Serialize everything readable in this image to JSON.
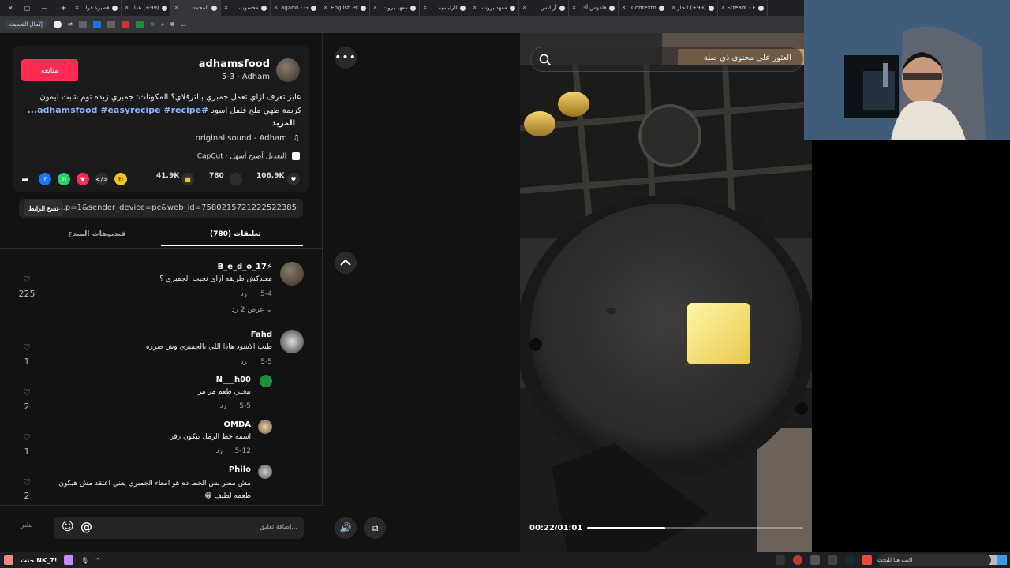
{
  "browser": {
    "tabs": [
      {
        "label": "قطيرة فرا..."
      },
      {
        "label": "(99+) هذا"
      },
      {
        "label": "المحمد",
        "active": true
      },
      {
        "label": "محسوب"
      },
      {
        "label": "agario - G"
      },
      {
        "label": "English Pr"
      },
      {
        "label": "معهد بروت"
      },
      {
        "label": "الرئيسية"
      },
      {
        "label": "معهد بروت"
      },
      {
        "label": "أرنلنس"
      },
      {
        "label": "قاموس أك"
      },
      {
        "label": "Contexto"
      },
      {
        "label": "(99+) الحار"
      },
      {
        "label": "Stream - F"
      }
    ],
    "new_tab": "+",
    "update_button": "إكمال التحديث"
  },
  "post": {
    "username": "adhamsfood",
    "meta": "5-3 · Adham",
    "follow_label": "متابعة",
    "description": "عايز تعرف ازاي تعمل جمبري بالترفلاي؟ المكونات: جمبري زبده ثوم شبت ليمون كريمة طهي ملح فلفل اسود",
    "hashtags": "#adhamsfood #easyrecipe #recipe...",
    "more_label": "المزيد",
    "sound": "original sound - Adham",
    "capcut": "CapCut · التعديل أصبح أسهل",
    "likes": "106.9K",
    "comments_count": "780",
    "saves": "41.9K",
    "link": "...p=1&sender_device=pc&web_id=7580215721222522385",
    "copy_link": "نسخ الرابط",
    "tab_comments": "تعليقات (780)",
    "tab_creator": "فيديوهات المبدع"
  },
  "comments": [
    {
      "name": "B_e_d_o_17⚡",
      "text": "معندكش طريقه ازاي نجيب الجمبري ؟",
      "date": "5-4",
      "reply": "رد",
      "likes": "225",
      "view_replies": "عرض 2 رد"
    },
    {
      "name": "Fahd",
      "text": "طيب الاسود هاذا اللي بالجمبري وش ضرره",
      "date": "5-5",
      "reply": "رد",
      "likes": "1"
    },
    {
      "name": "N___h00",
      "text": "بيخلي طعم مر مر",
      "date": "5-5",
      "reply": "رد",
      "likes": "2"
    },
    {
      "name": "OMDA",
      "text": "اسمه خط الرمل بيكون زفر",
      "date": "5-12",
      "reply": "رد",
      "likes": "1"
    },
    {
      "name": "Philo",
      "text": "مش مضر بس الخط ده هو امعاء الجمبري يعني اعتقد مش هيكون طعمه لطيف 😁",
      "likes": "2"
    }
  ],
  "comment_input": {
    "placeholder": "إضافة تعليق...",
    "post": "نشر"
  },
  "video": {
    "search_placeholder": "العثور على محتوى ذي صلة",
    "time": "00:22/01:01",
    "progress": 0.36
  },
  "taskbar": {
    "search_placeholder": "اكتب هنا للبحث",
    "ticker": "جنت NK_7!"
  },
  "colors": {
    "accent": "#fe2c55",
    "link": "#8ab4f8"
  }
}
